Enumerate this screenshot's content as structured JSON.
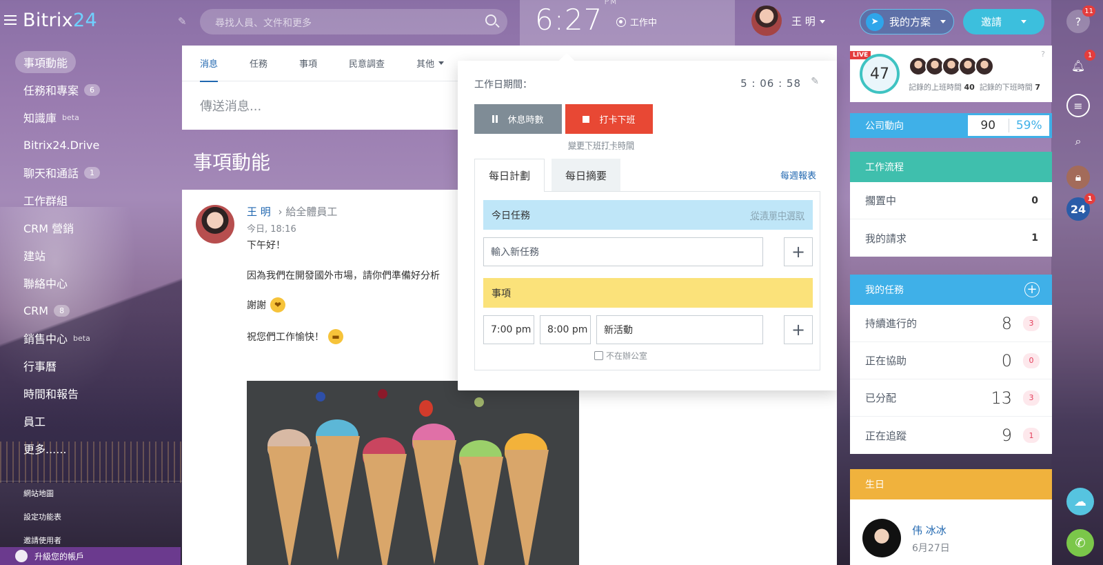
{
  "brand": {
    "name": "Bitrix",
    "num": "24"
  },
  "search": {
    "placeholder": "尋找人員、文件和更多"
  },
  "clock": {
    "time": "6:27",
    "ampm": "PM",
    "status": "工作中"
  },
  "user": {
    "name": "王 明"
  },
  "header": {
    "plan_label": "我的方案",
    "invite_label": "邀請"
  },
  "sidebar": {
    "items": [
      {
        "label": "事項動能",
        "count": ""
      },
      {
        "label": "任務和專案",
        "count": "6"
      },
      {
        "label": "知識庫",
        "count": "",
        "sup": "beta"
      },
      {
        "label": "Bitrix24.Drive",
        "count": ""
      },
      {
        "label": "聊天和通話",
        "count": "1"
      },
      {
        "label": "工作群組",
        "count": ""
      },
      {
        "label": "CRM 營銷",
        "count": ""
      },
      {
        "label": "建站",
        "count": ""
      },
      {
        "label": "聯絡中心",
        "count": ""
      },
      {
        "label": "CRM",
        "count": "8"
      },
      {
        "label": "銷售中心",
        "count": "",
        "sup": "beta"
      },
      {
        "label": "行事曆",
        "count": ""
      },
      {
        "label": "時間和報告",
        "count": ""
      },
      {
        "label": "員工",
        "count": ""
      },
      {
        "label": "更多......",
        "count": ""
      }
    ],
    "sub": [
      "網站地圖",
      "設定功能表",
      "邀請使用者"
    ],
    "upgrade": "升級您的帳戶"
  },
  "composer": {
    "tabs": [
      "消息",
      "任務",
      "事項",
      "民意調查",
      "其他"
    ],
    "placeholder": "傳送消息..."
  },
  "page_title": "事項動能",
  "post": {
    "author": "王 明",
    "to": "給全體員工",
    "time": "今日, 18:16",
    "line1": "下午好！",
    "line2": "因為我們在開發國外市場，請你們準備好分析",
    "line3": "謝謝",
    "line4": "祝您們工作愉快！"
  },
  "workday": {
    "label": "工作日期間：",
    "duration": "5 : 06 : 58",
    "pause_label": "休息時數",
    "stop_label": "打卡下班",
    "change_link": "變更下班打卡時間",
    "tab_plan": "每日計劃",
    "tab_summary": "每日摘要",
    "weekly": "每週報表",
    "today_tasks": "今日任務",
    "pick_list": "從清單中選取",
    "new_task_placeholder": "輸入新任務",
    "events": "事項",
    "event_from": "7:00 pm",
    "event_to": "8:00 pm",
    "event_name": "新活動",
    "out_of_office": "不在辦公室"
  },
  "live": {
    "tag": "LIVE",
    "count": "47",
    "checkin_label": "記錄的上班時間",
    "checkin_count": "40",
    "checkout_label": "記錄的下班時間",
    "checkout_count": "7",
    "help": "?"
  },
  "company": {
    "label": "公司動向",
    "score": "90",
    "percent": "59%"
  },
  "workflow": {
    "title": "工作流程",
    "rows": [
      {
        "label": "擱置中",
        "value": "0"
      },
      {
        "label": "我的請求",
        "value": "1"
      }
    ]
  },
  "my_tasks": {
    "title": "我的任務",
    "rows": [
      {
        "label": "持續進行的",
        "value": "8",
        "badge": "3"
      },
      {
        "label": "正在協助",
        "value": "0",
        "badge": "0"
      },
      {
        "label": "已分配",
        "value": "13",
        "badge": "3"
      },
      {
        "label": "正在追蹤",
        "value": "9",
        "badge": "1"
      }
    ]
  },
  "birthday": {
    "title": "生日",
    "name": "伟 冰冰",
    "date": "6月27日"
  },
  "iconbar": {
    "help_badge": "11",
    "bell_badge": "1",
    "b24_badge": "1",
    "b24_label": "24"
  },
  "colors": {
    "accent": "#2067b0",
    "stop": "#e84834",
    "today_bar": "#bfe6f8",
    "events_bar": "#fbe27a",
    "workflow_head": "#3fbfad",
    "tasks_head": "#3fb0e8",
    "birthday_head": "#f0b23d"
  }
}
